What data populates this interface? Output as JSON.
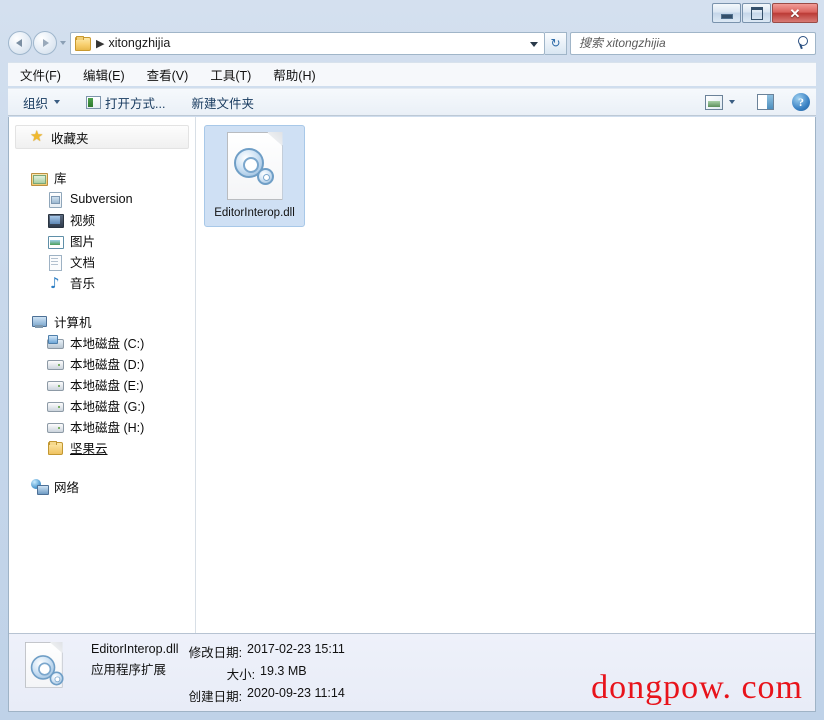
{
  "window": {
    "buttons": {
      "minimize": "−",
      "maximize": "□",
      "close": "✕"
    }
  },
  "nav": {
    "back_tooltip": "后退",
    "forward_tooltip": "前进",
    "history_tooltip": "最近访问的位置",
    "breadcrumb_separator": "▶",
    "path": "xitongzhijia",
    "refresh_glyph": "↻",
    "dropdown_glyph": "▼"
  },
  "search": {
    "placeholder": "搜索 xitongzhijia",
    "value": ""
  },
  "menu": {
    "items": [
      {
        "label": "文件(F)"
      },
      {
        "label": "编辑(E)"
      },
      {
        "label": "查看(V)"
      },
      {
        "label": "工具(T)"
      },
      {
        "label": "帮助(H)"
      }
    ]
  },
  "toolbar": {
    "organize": "组织",
    "open_with": "打开方式...",
    "new_folder": "新建文件夹",
    "help_glyph": "?"
  },
  "sidebar": {
    "favorites": {
      "label": "收藏夹",
      "icon": "star-icon"
    },
    "library": {
      "label": "库",
      "icon": "library-icon",
      "items": [
        {
          "label": "Subversion",
          "icon": "subversion-icon"
        },
        {
          "label": "视频",
          "icon": "video-icon"
        },
        {
          "label": "图片",
          "icon": "pictures-icon"
        },
        {
          "label": "文档",
          "icon": "documents-icon"
        },
        {
          "label": "音乐",
          "icon": "music-icon"
        }
      ]
    },
    "computer": {
      "label": "计算机",
      "icon": "computer-icon",
      "items": [
        {
          "label": "本地磁盘 (C:)",
          "icon": "system-drive-icon"
        },
        {
          "label": "本地磁盘 (D:)",
          "icon": "drive-icon"
        },
        {
          "label": "本地磁盘 (E:)",
          "icon": "drive-icon"
        },
        {
          "label": "本地磁盘 (G:)",
          "icon": "drive-icon"
        },
        {
          "label": "本地磁盘 (H:)",
          "icon": "drive-icon"
        },
        {
          "label": "坚果云",
          "icon": "folder-icon"
        }
      ]
    },
    "network": {
      "label": "网络",
      "icon": "network-icon"
    }
  },
  "content": {
    "files": [
      {
        "name": "EditorInterop.dll",
        "icon": "dll-file-icon",
        "selected": true
      }
    ]
  },
  "status": {
    "file_name": "EditorInterop.dll",
    "file_type": "应用程序扩展",
    "modified_label": "修改日期:",
    "modified_value": "2017-02-23 15:11",
    "size_label": "大小:",
    "size_value": "19.3 MB",
    "created_label": "创建日期:",
    "created_value": "2020-09-23 11:14"
  },
  "watermark": {
    "text": "dongpow. com",
    "color": "#e8131b"
  }
}
